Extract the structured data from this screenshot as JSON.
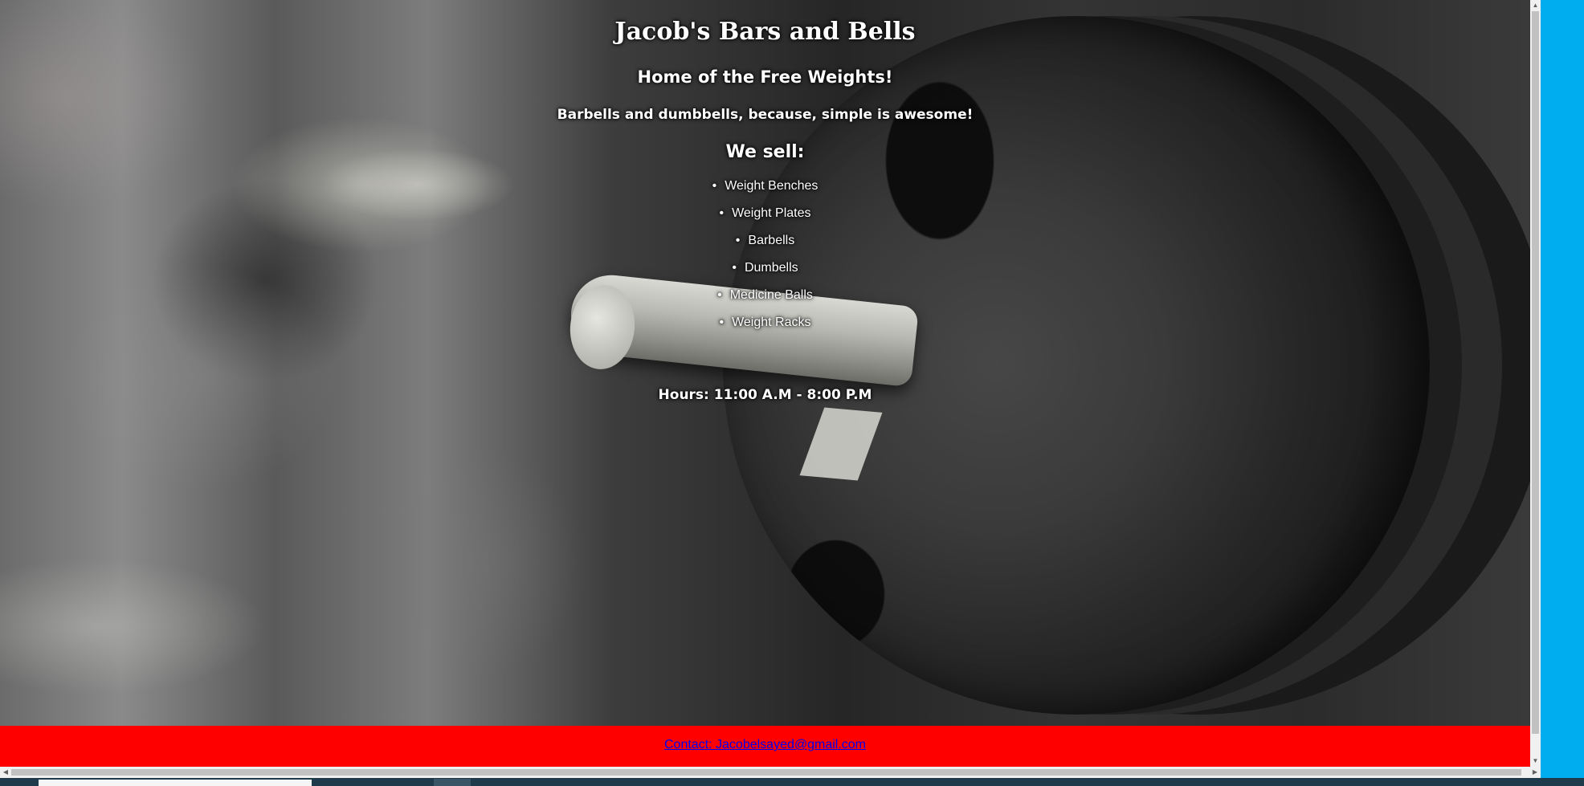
{
  "site": {
    "title": "Jacob's Bars and Bells",
    "tagline": "Home of the Free Weights!",
    "subtagline": "Barbells and dumbbells, because, simple is awesome!",
    "we_sell_heading": "We sell:",
    "products": [
      "Weight Benches",
      "Weight Plates",
      "Barbells",
      "Dumbells",
      "Medicine Balls",
      "Weight Racks"
    ],
    "bullet": "•",
    "hours": "Hours: 11:00 A.M - 8:00 P.M"
  },
  "footer": {
    "contact_label": "Contact: Jacobelsayed@gmail.com",
    "background_color": "#ff0000"
  },
  "browser": {
    "scroll_up_icon": "▲",
    "scroll_down_icon": "▼",
    "scroll_left_icon": "◀",
    "scroll_right_icon": "▶"
  },
  "colors": {
    "side_panel": "#00aef0",
    "link": "#0000ee"
  }
}
